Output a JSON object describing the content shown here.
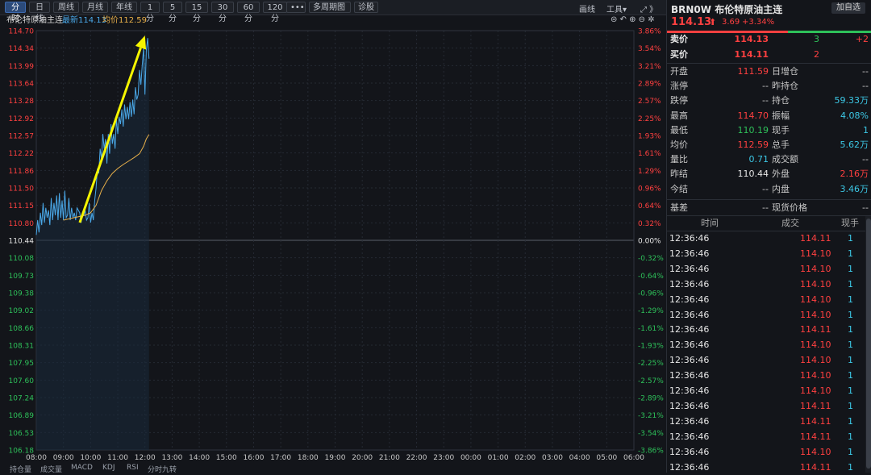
{
  "toolbar": {
    "periods": [
      "分时",
      "日线",
      "周线",
      "月线",
      "年线",
      "1分",
      "5分",
      "15分",
      "30分",
      "60分",
      "120分"
    ],
    "more": "•••",
    "multi": "多周期图",
    "diagnose": "诊股",
    "draw": "画线",
    "tools": "工具▾",
    "right_icons": "⤢ 》",
    "ctrl_icons": "⊜ ↶ ⊕ ⊖ ✲"
  },
  "info": {
    "name": "布伦特原油主连",
    "latest_label": "最新114.13",
    "avg_label": "均价112.59"
  },
  "colors": {
    "up": "#ff4040",
    "down": "#2ec15a",
    "price_line": "#4aa8e8",
    "avg_line": "#e8b04a",
    "arrow": "#f5f500",
    "grid": "#252a33"
  },
  "chart_data": {
    "type": "line",
    "prev_close": 110.44,
    "y_ticks": [
      "114.70",
      "114.34",
      "113.99",
      "113.64",
      "113.28",
      "112.92",
      "112.57",
      "112.22",
      "111.86",
      "111.50",
      "111.15",
      "110.80",
      "110.44",
      "110.08",
      "109.73",
      "109.38",
      "109.02",
      "108.66",
      "108.31",
      "107.95",
      "107.60",
      "107.24",
      "106.89",
      "106.53",
      "106.18"
    ],
    "pct_ticks": [
      "3.86%",
      "3.54%",
      "3.21%",
      "2.89%",
      "2.57%",
      "2.25%",
      "1.93%",
      "1.61%",
      "1.29%",
      "0.96%",
      "0.64%",
      "0.32%",
      "0.00%",
      "-0.32%",
      "-0.64%",
      "-0.96%",
      "-1.29%",
      "-1.61%",
      "-1.93%",
      "-2.25%",
      "-2.57%",
      "-2.89%",
      "-3.21%",
      "-3.54%",
      "-3.86%"
    ],
    "x_ticks": [
      "08:00",
      "09:00",
      "10:00",
      "11:00",
      "12:00",
      "13:00",
      "14:00",
      "15:00",
      "16:00",
      "17:00",
      "18:00",
      "19:00",
      "20:00",
      "21:00",
      "22:00",
      "23:00",
      "00:00",
      "01:00",
      "02:00",
      "03:00",
      "04:00",
      "05:00",
      "06:00"
    ],
    "ylim": [
      106.18,
      114.7
    ],
    "price": [
      [
        0,
        110.55
      ],
      [
        0.05,
        110.85
      ],
      [
        0.1,
        110.6
      ],
      [
        0.15,
        111.0
      ],
      [
        0.2,
        110.75
      ],
      [
        0.25,
        111.2
      ],
      [
        0.3,
        110.8
      ],
      [
        0.35,
        111.1
      ],
      [
        0.4,
        110.9
      ],
      [
        0.45,
        111.05
      ],
      [
        0.5,
        110.75
      ],
      [
        0.55,
        111.3
      ],
      [
        0.6,
        110.85
      ],
      [
        0.65,
        111.2
      ],
      [
        0.7,
        110.95
      ],
      [
        0.75,
        111.35
      ],
      [
        0.8,
        110.85
      ],
      [
        0.85,
        111.4
      ],
      [
        0.9,
        110.9
      ],
      [
        0.95,
        111.25
      ],
      [
        1.0,
        110.85
      ],
      [
        1.05,
        111.45
      ],
      [
        1.1,
        110.9
      ],
      [
        1.15,
        110.95
      ],
      [
        1.2,
        111.3
      ],
      [
        1.25,
        110.85
      ],
      [
        1.3,
        111.1
      ],
      [
        1.35,
        110.9
      ],
      [
        1.4,
        111.0
      ],
      [
        1.45,
        110.85
      ],
      [
        1.5,
        111.1
      ],
      [
        1.55,
        111.05
      ],
      [
        1.6,
        111.0
      ],
      [
        1.65,
        110.8
      ],
      [
        1.7,
        111.0
      ],
      [
        1.75,
        110.95
      ],
      [
        1.8,
        111.05
      ],
      [
        1.85,
        110.85
      ],
      [
        1.9,
        110.9
      ],
      [
        1.95,
        111.2
      ],
      [
        2.0,
        110.8
      ],
      [
        2.05,
        111.0
      ],
      [
        2.1,
        110.85
      ],
      [
        2.15,
        111.25
      ],
      [
        2.2,
        111.5
      ],
      [
        2.25,
        111.9
      ],
      [
        2.3,
        111.8
      ],
      [
        2.35,
        112.3
      ],
      [
        2.4,
        112.1
      ],
      [
        2.45,
        112.6
      ],
      [
        2.5,
        112.3
      ],
      [
        2.55,
        112.5
      ],
      [
        2.6,
        112.0
      ],
      [
        2.65,
        112.6
      ],
      [
        2.7,
        112.2
      ],
      [
        2.75,
        112.8
      ],
      [
        2.8,
        112.4
      ],
      [
        2.85,
        112.6
      ],
      [
        2.9,
        112.3
      ],
      [
        2.95,
        112.9
      ],
      [
        3.0,
        112.6
      ],
      [
        3.05,
        112.95
      ],
      [
        3.1,
        112.8
      ],
      [
        3.15,
        113.1
      ],
      [
        3.2,
        112.75
      ],
      [
        3.25,
        113.2
      ],
      [
        3.3,
        112.9
      ],
      [
        3.35,
        113.15
      ],
      [
        3.4,
        112.9
      ],
      [
        3.45,
        113.25
      ],
      [
        3.5,
        112.95
      ],
      [
        3.55,
        113.3
      ],
      [
        3.6,
        113.0
      ],
      [
        3.65,
        113.55
      ],
      [
        3.7,
        113.3
      ],
      [
        3.75,
        113.4
      ],
      [
        3.8,
        113.9
      ],
      [
        3.85,
        113.6
      ],
      [
        3.9,
        114.0
      ],
      [
        3.95,
        114.35
      ],
      [
        4.0,
        113.4
      ],
      [
        4.05,
        114.3
      ],
      [
        4.1,
        114.55
      ],
      [
        4.15,
        114.13
      ]
    ],
    "avg": [
      [
        1.0,
        110.85
      ],
      [
        1.4,
        110.9
      ],
      [
        1.8,
        110.95
      ],
      [
        2.0,
        111.0
      ],
      [
        2.2,
        111.15
      ],
      [
        2.4,
        111.45
      ],
      [
        2.6,
        111.65
      ],
      [
        2.8,
        111.8
      ],
      [
        3.0,
        111.9
      ],
      [
        3.2,
        111.98
      ],
      [
        3.4,
        112.05
      ],
      [
        3.6,
        112.12
      ],
      [
        3.8,
        112.2
      ],
      [
        3.95,
        112.35
      ],
      [
        4.05,
        112.5
      ],
      [
        4.15,
        112.59
      ]
    ],
    "arrow": {
      "from": [
        1.6,
        110.8
      ],
      "to": [
        4.0,
        114.6
      ]
    }
  },
  "bottom_tabs": [
    "持仓量",
    "成交量",
    "MACD",
    "KDJ",
    "RSI",
    "分时九转"
  ],
  "panel": {
    "title": "BRN0W 布伦特原油主连",
    "add_btn": "加自选",
    "price": "114.13",
    "change": "3.69",
    "change_pct": "+3.34%",
    "sell": {
      "label": "卖价",
      "price": "114.13",
      "vol": "3",
      "delta": "+2"
    },
    "buy": {
      "label": "买价",
      "price": "114.11",
      "vol": "2"
    },
    "stats": [
      {
        "l1": "开盘",
        "v1": "111.59",
        "c1": "red",
        "l2": "日增仓",
        "v2": "--",
        "c2": "gray"
      },
      {
        "l1": "涨停",
        "v1": "--",
        "c1": "gray",
        "l2": "昨持仓",
        "v2": "--",
        "c2": "gray"
      },
      {
        "l1": "跌停",
        "v1": "--",
        "c1": "gray",
        "l2": "持仓",
        "v2": "59.33万",
        "c2": "cyan"
      },
      {
        "l1": "最高",
        "v1": "114.70",
        "c1": "red",
        "l2": "振幅",
        "v2": "4.08%",
        "c2": "cyan"
      },
      {
        "l1": "最低",
        "v1": "110.19",
        "c1": "green",
        "l2": "现手",
        "v2": "1",
        "c2": "cyan"
      },
      {
        "l1": "均价",
        "v1": "112.59",
        "c1": "red",
        "l2": "总手",
        "v2": "5.62万",
        "c2": "cyan"
      },
      {
        "l1": "量比",
        "v1": "0.71",
        "c1": "cyan",
        "l2": "成交额",
        "v2": "--",
        "c2": "gray"
      },
      {
        "l1": "昨结",
        "v1": "110.44",
        "c1": "white",
        "l2": "外盘",
        "v2": "2.16万",
        "c2": "red"
      },
      {
        "l1": "今结",
        "v1": "--",
        "c1": "gray",
        "l2": "内盘",
        "v2": "3.46万",
        "c2": "cyan"
      }
    ],
    "basis": {
      "label": "基差",
      "value": "--",
      "spot_label": "现货价格",
      "spot_value": "--"
    },
    "ticks_header": {
      "time": "时间",
      "price": "成交",
      "vol": "现手"
    },
    "ticks": [
      {
        "time": "12:36:46",
        "price": "114.11",
        "vol": "1"
      },
      {
        "time": "12:36:46",
        "price": "114.10",
        "vol": "1"
      },
      {
        "time": "12:36:46",
        "price": "114.10",
        "vol": "1"
      },
      {
        "time": "12:36:46",
        "price": "114.10",
        "vol": "1"
      },
      {
        "time": "12:36:46",
        "price": "114.10",
        "vol": "1"
      },
      {
        "time": "12:36:46",
        "price": "114.10",
        "vol": "1"
      },
      {
        "time": "12:36:46",
        "price": "114.11",
        "vol": "1"
      },
      {
        "time": "12:36:46",
        "price": "114.10",
        "vol": "1"
      },
      {
        "time": "12:36:46",
        "price": "114.10",
        "vol": "1"
      },
      {
        "time": "12:36:46",
        "price": "114.10",
        "vol": "1"
      },
      {
        "time": "12:36:46",
        "price": "114.10",
        "vol": "1"
      },
      {
        "time": "12:36:46",
        "price": "114.11",
        "vol": "1"
      },
      {
        "time": "12:36:46",
        "price": "114.11",
        "vol": "1"
      },
      {
        "time": "12:36:46",
        "price": "114.11",
        "vol": "1"
      },
      {
        "time": "12:36:46",
        "price": "114.10",
        "vol": "1"
      },
      {
        "time": "12:36:46",
        "price": "114.11",
        "vol": "1"
      }
    ]
  }
}
